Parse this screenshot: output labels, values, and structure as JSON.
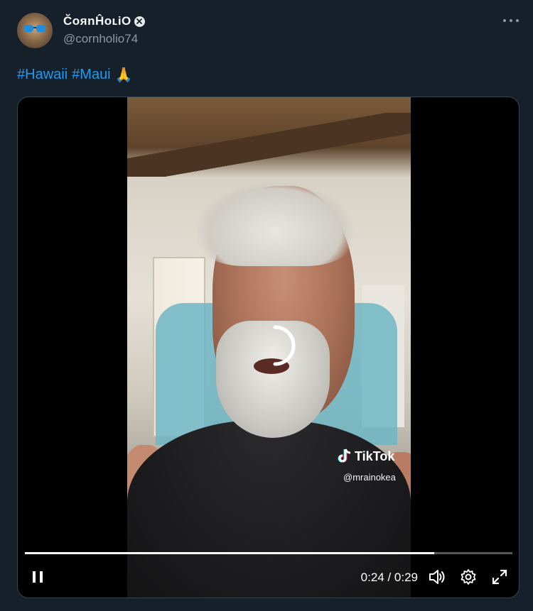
{
  "tweet": {
    "author": {
      "display_name": "C̆ᴏяnĤoʟiO",
      "handle": "@cornholio74",
      "verified": true
    },
    "text": {
      "hashtags": [
        "#Hawaii",
        "#Maui"
      ],
      "emoji": "🙏"
    },
    "more_icon": "ellipsis-icon"
  },
  "video": {
    "watermark": {
      "brand": "TikTok",
      "username": "@mrainokea"
    },
    "progress": 0.84,
    "time_current": "0:24",
    "time_total": "0:29",
    "time_display": "0:24 / 0:29",
    "state": "playing",
    "controls": [
      "pause-icon",
      "volume-icon",
      "settings-icon",
      "fullscreen-icon"
    ]
  },
  "colors": {
    "background": "#15202b",
    "link": "#1d9bf0",
    "secondary_text": "#8b98a5"
  }
}
